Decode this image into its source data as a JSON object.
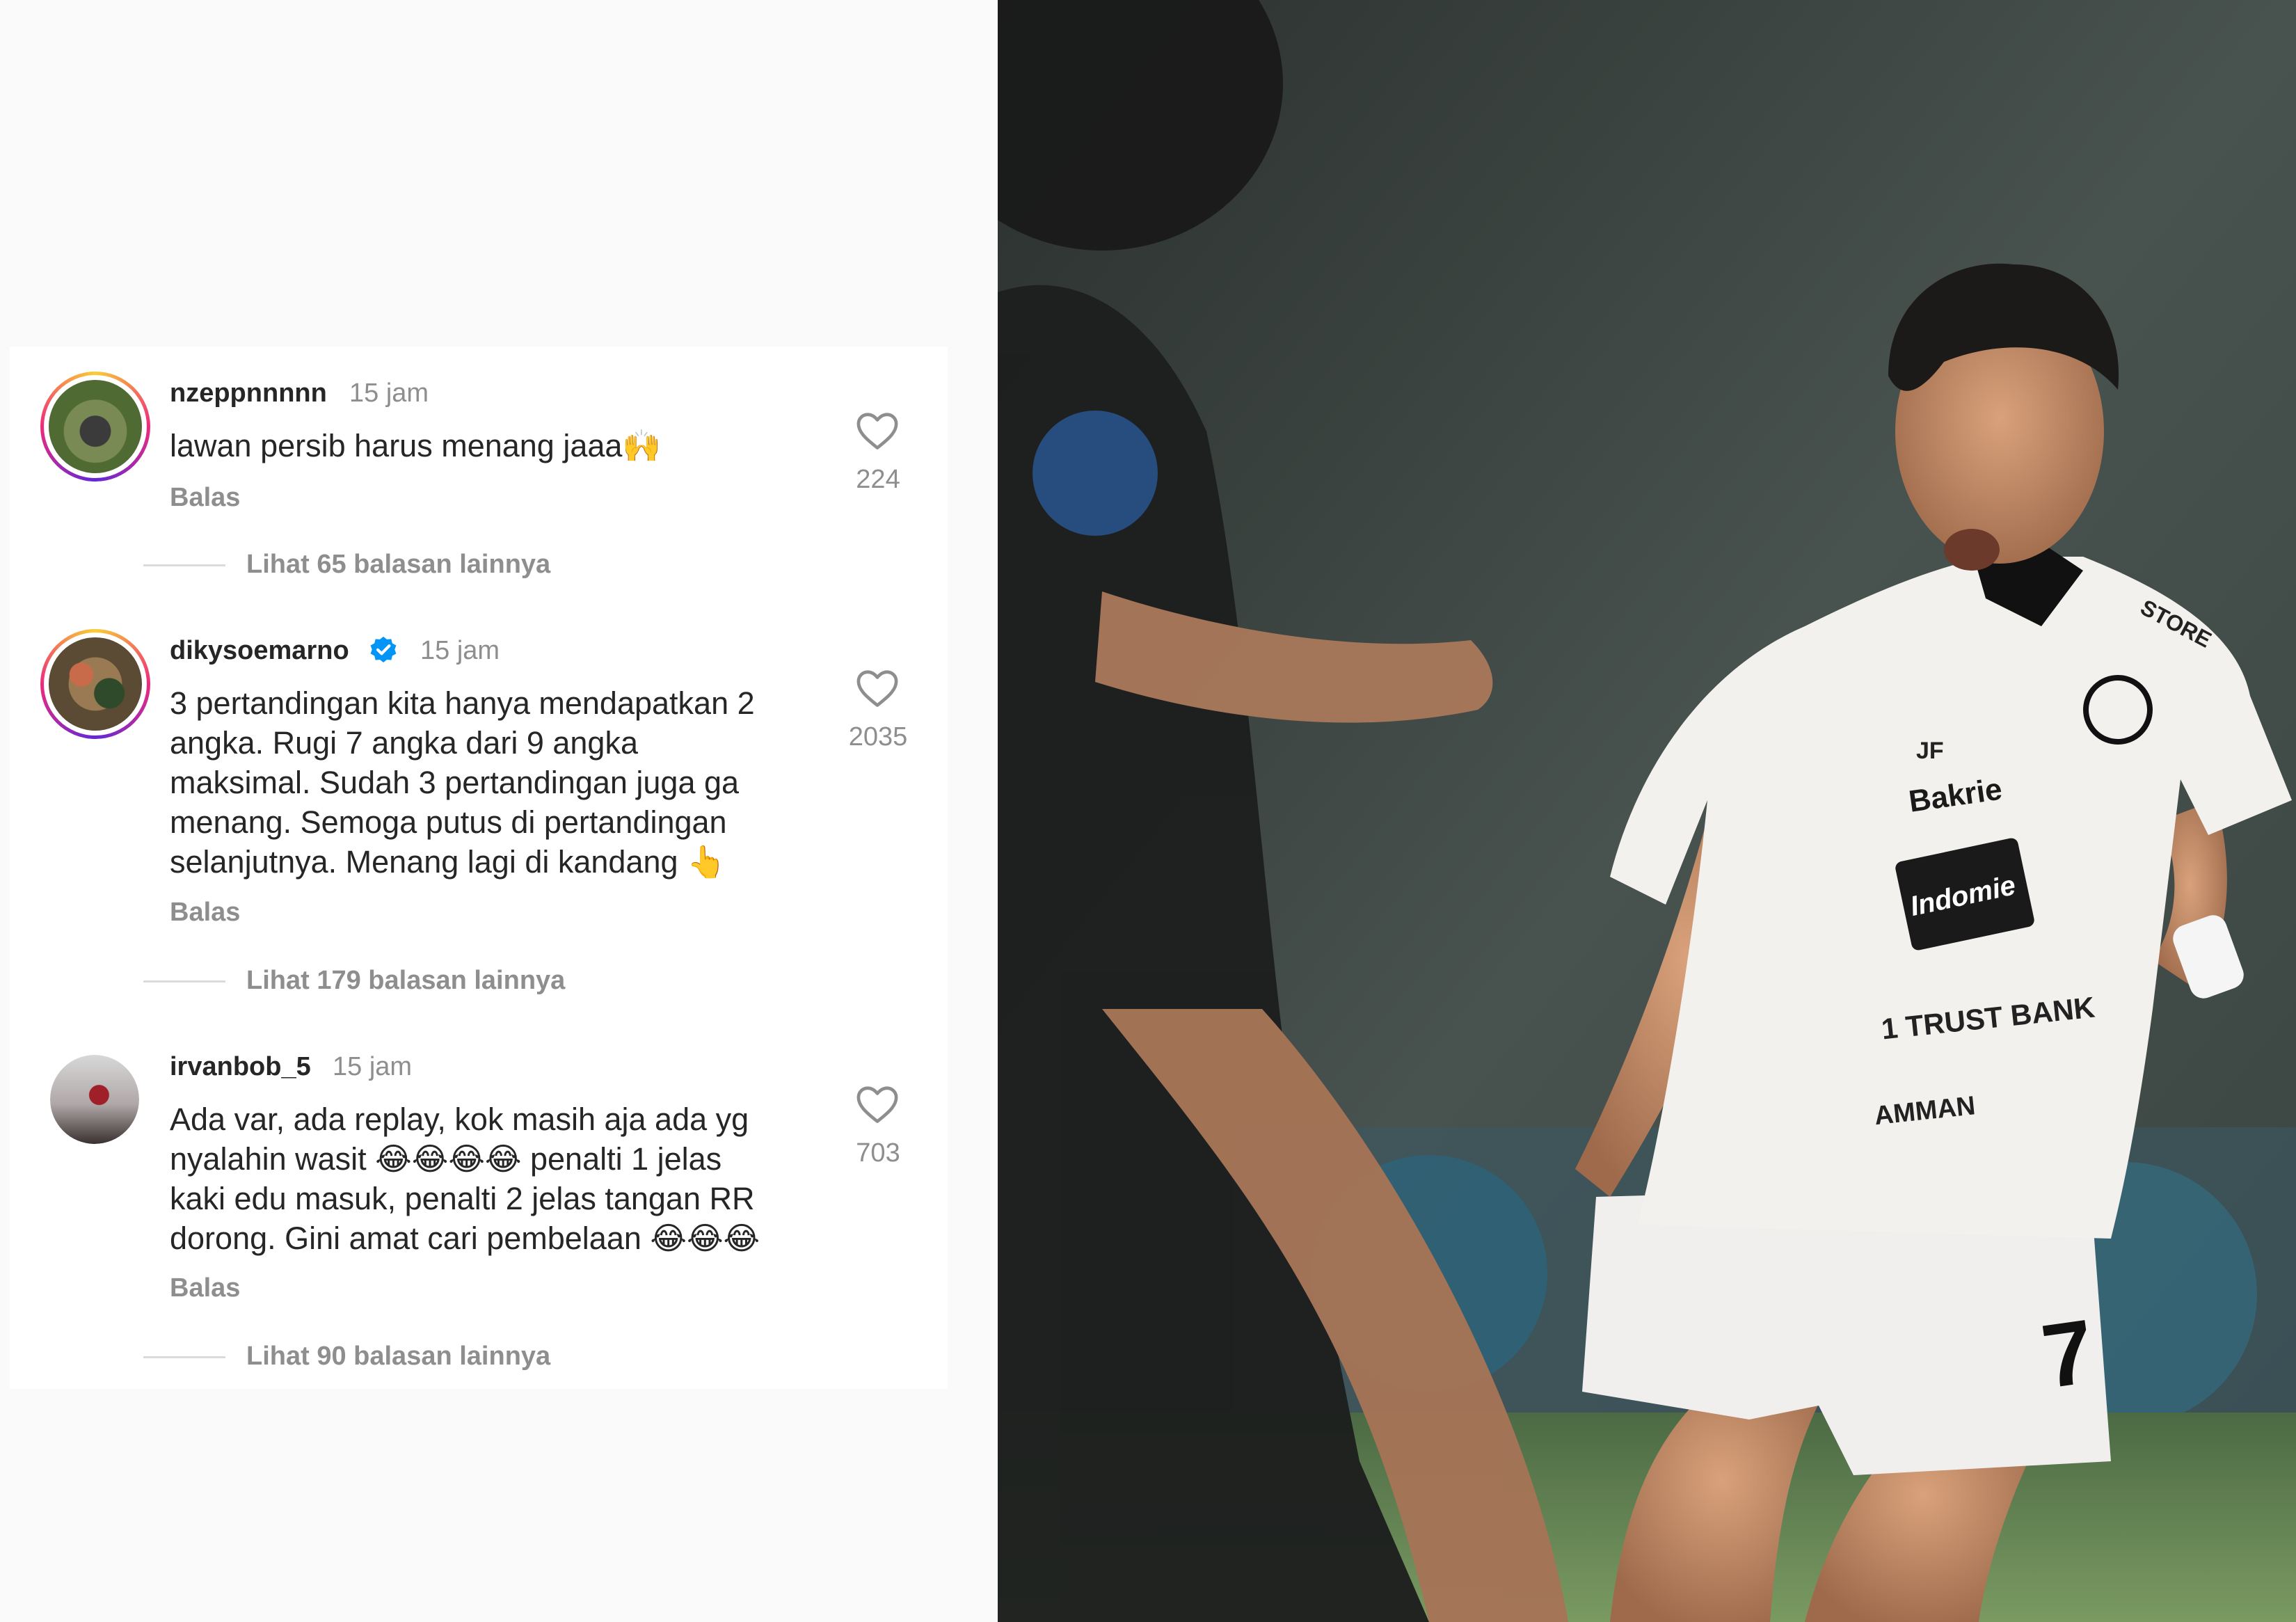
{
  "comments": [
    {
      "username": "nzeppnnnnn",
      "time": "15 jam",
      "text": "lawan persib harus menang jaaa🙌",
      "reply": "Balas",
      "likes": "224",
      "more_replies": "Lihat 65 balasan lainnya",
      "avatar_icon": "avatar-story-ring",
      "verified": false
    },
    {
      "username": "dikysoemarno",
      "time": "15 jam",
      "text": "3 pertandingan kita hanya mendapatkan 2\nangka. Rugi 7 angka dari 9 angka\nmaksimal. Sudah 3 pertandingan juga ga\nmenang. Semoga putus di pertandingan\nselanjutnya. Menang lagi di kandang 👆",
      "reply": "Balas",
      "likes": "2035",
      "more_replies": "Lihat 179 balasan lainnya",
      "avatar_icon": "avatar-story-ring",
      "verified": true
    },
    {
      "username": "irvanbob_5",
      "time": "15 jam",
      "text": "Ada var, ada replay, kok masih aja ada yg\nnyalahin wasit 😂😂😂😂 penalti 1 jelas\nkaki edu masuk, penalti 2 jelas tangan RR\ndorong. Gini amat cari pembelaan 😂😂😂",
      "reply": "Balas",
      "likes": "703",
      "more_replies": "Lihat 90 balasan lainnya",
      "avatar_icon": "avatar-plain",
      "verified": false
    }
  ],
  "photo": {
    "jersey_number": "7",
    "sponsors": [
      "Bakrie",
      "Indomie",
      "1 TRUST BANK",
      "AMMAN",
      "JF",
      "STORE"
    ]
  },
  "colors": {
    "text_primary": "#262626",
    "text_secondary": "#8e8e8e",
    "verified_blue": "#0095f6",
    "background": "#fafafa"
  }
}
